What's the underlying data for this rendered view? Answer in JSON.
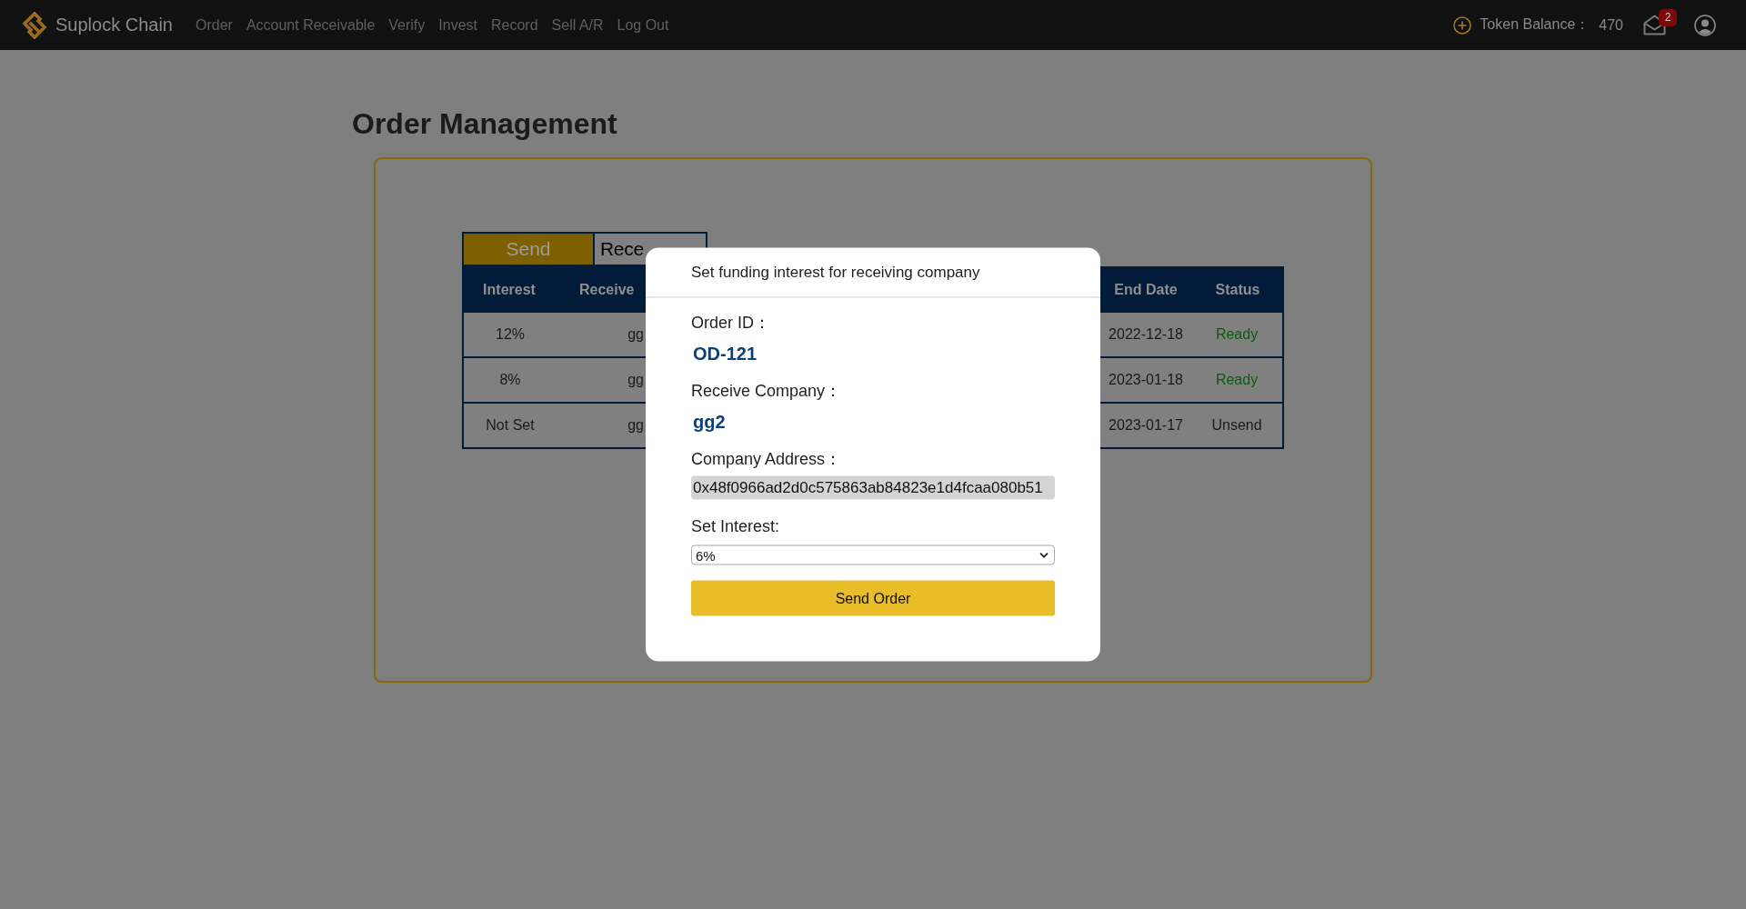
{
  "navbar": {
    "brand": "Suplock Chain",
    "links": [
      "Order",
      "Account Receivable",
      "Verify",
      "Invest",
      "Record",
      "Sell A/R",
      "Log Out"
    ],
    "token_label": "Token Balance：",
    "token_value": "470",
    "notification_count": "2"
  },
  "page_title": "Order Management",
  "tabs": [
    {
      "label": "Send",
      "selected": true
    },
    {
      "label": "Rece",
      "selected": false
    }
  ],
  "table": {
    "columns": [
      "Interest",
      "Receive",
      "End Date",
      "Status"
    ],
    "rows": [
      {
        "cells": [
          "12%",
          "gg",
          "2022-12-18",
          "Ready"
        ],
        "color": "#0b5d0b"
      },
      {
        "cells": [
          "8%",
          "gg",
          "2023-01-18",
          "Ready"
        ],
        "color": "#0b5d0b"
      },
      {
        "cells": [
          "Not Set",
          "gg",
          "2023-01-17",
          "Unsend"
        ],
        "color": "#1a1a1a"
      }
    ]
  },
  "modal": {
    "title": "Set funding interest for receiving company",
    "fields": [
      {
        "kind": "text",
        "label": "Order ID：",
        "value": "OD-121"
      },
      {
        "kind": "text",
        "label": "Receive Company：",
        "value": "gg2"
      },
      {
        "kind": "readonly",
        "label": "Company Address：",
        "value": "0x48f0966ad2d0c575863ab84823e1d4fcaa080b51"
      },
      {
        "kind": "select",
        "label": "Set Interest:",
        "value": "6%"
      }
    ],
    "button": "Send Order"
  }
}
